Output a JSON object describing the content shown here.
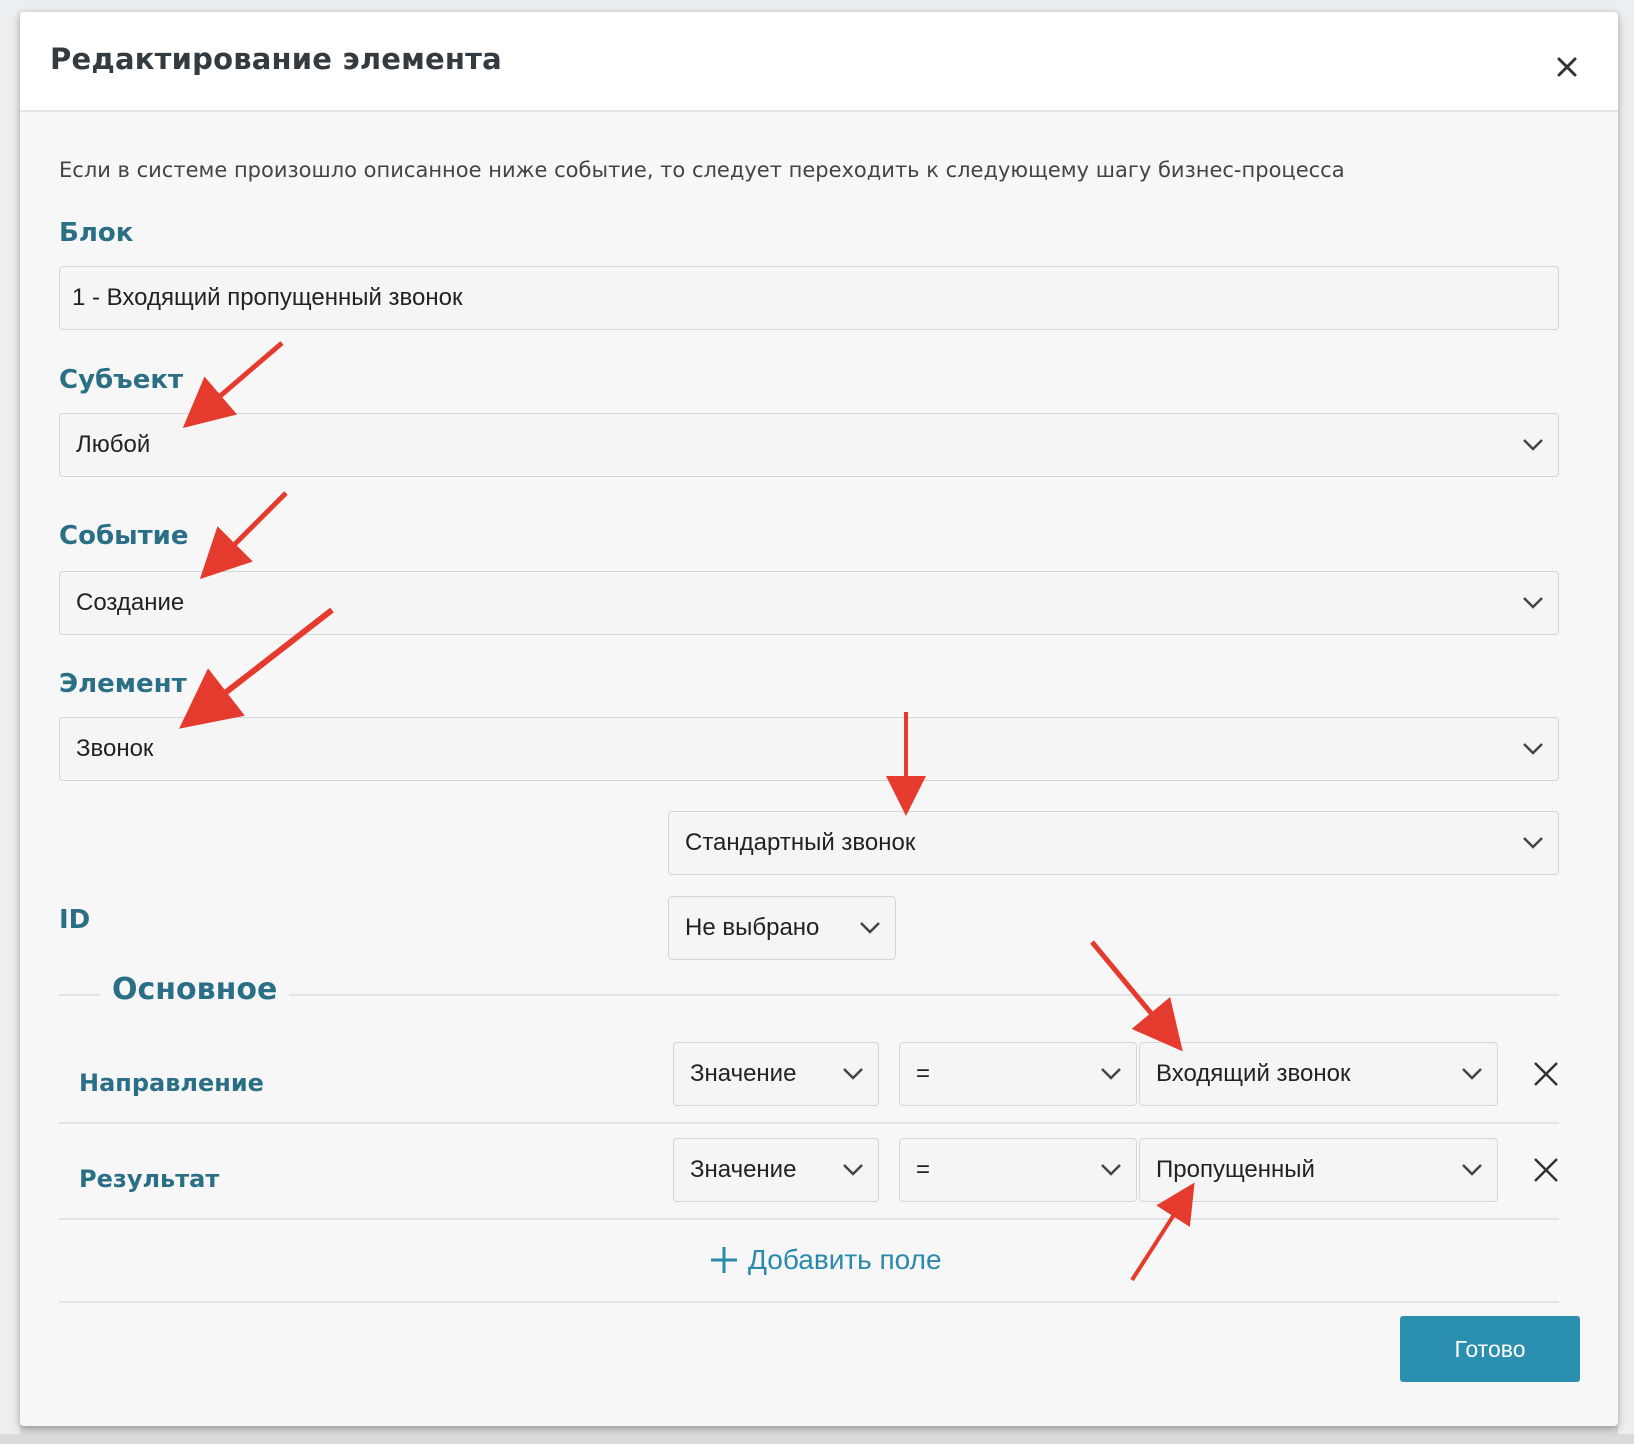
{
  "modal": {
    "title": "Редактирование элемента",
    "intro": "Если в системе произошло описанное ниже событие, то следует переходить к следующему шагу бизнес-процесса"
  },
  "block": {
    "label": "Блок",
    "value": "1 - Входящий пропущенный звонок"
  },
  "subject": {
    "label": "Субъект",
    "value": "Любой"
  },
  "event": {
    "label": "Событие",
    "value": "Создание"
  },
  "element": {
    "label": "Элемент",
    "value": "Звонок",
    "subtype": "Стандартный звонок"
  },
  "id_field": {
    "label": "ID",
    "value": "Не выбрано"
  },
  "section": {
    "title": "Основное",
    "rows": [
      {
        "label": "Направление",
        "source": "Значение",
        "operator": "=",
        "value": "Входящий звонок"
      },
      {
        "label": "Результат",
        "source": "Значение",
        "operator": "=",
        "value": "Пропущенный"
      }
    ]
  },
  "add_field_label": "Добавить поле",
  "done_label": "Готово",
  "colors": {
    "accent": "#2a6f85",
    "button": "#2b8fb0",
    "annotation": "#e53b2f"
  }
}
